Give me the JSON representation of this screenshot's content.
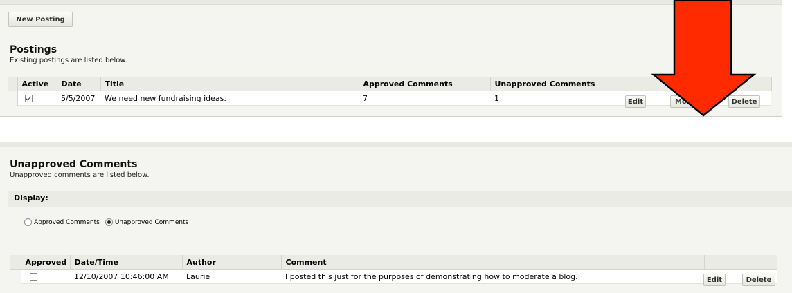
{
  "toolbar": {
    "new_posting_label": "New Posting"
  },
  "postings": {
    "title": "Postings",
    "subtitle": "Existing postings are listed below.",
    "columns": [
      "Active",
      "Date",
      "Title",
      "Approved Comments",
      "Unapproved Comments"
    ],
    "rows": [
      {
        "active": true,
        "date": "5/5/2007",
        "title": "We need new fundraising ideas.",
        "approved": "7",
        "unapproved": "1"
      }
    ],
    "actions": {
      "edit": "Edit",
      "moderate": "Moderate",
      "delete": "Delete"
    }
  },
  "unapproved": {
    "title": "Unapproved Comments",
    "subtitle": "Unapproved comments are listed below.",
    "display_label": "Display:",
    "radio": {
      "approved_label": "Approved Comments",
      "unapproved_label": "Unapproved Comments",
      "selected": "unapproved"
    },
    "columns": [
      "Approved",
      "Date/Time",
      "Author",
      "Comment"
    ],
    "rows": [
      {
        "approved": false,
        "datetime": "12/10/2007 10:46:00 AM",
        "author": "Laurie",
        "comment": "I posted this just for the purposes of demonstrating how to moderate a blog."
      }
    ],
    "actions": {
      "edit": "Edit",
      "delete": "Delete"
    }
  },
  "colors": {
    "arrow": "#ff2a00",
    "panel": "#f4f4f0",
    "header": "#ebebe6"
  }
}
